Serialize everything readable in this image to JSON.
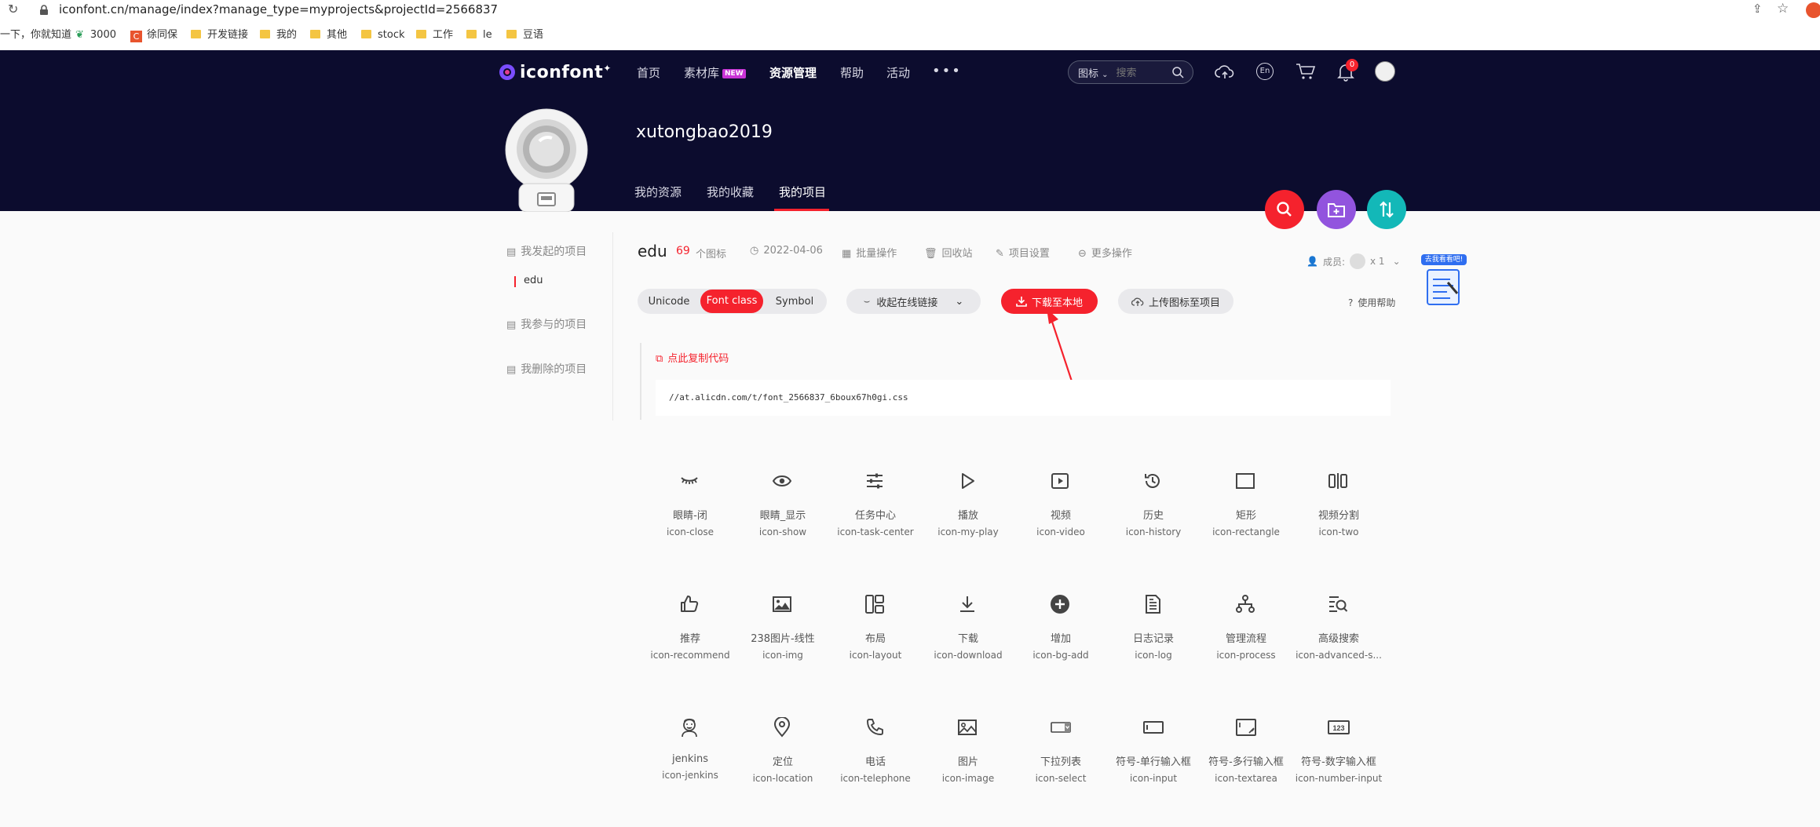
{
  "browser": {
    "url": "iconfont.cn/manage/index?manage_type=myprojects&projectId=2566837",
    "bookmarks": [
      "一下，你就知道",
      "3000",
      "徐同保",
      "开发链接",
      "我的",
      "其他",
      "stock",
      "工作",
      "le",
      "豆语"
    ]
  },
  "header": {
    "logo": "iconfont",
    "nav": [
      "首页",
      "素材库",
      "资源管理",
      "帮助",
      "活动"
    ],
    "nav_badge": "NEW",
    "search_scope": "图标",
    "search_placeholder": "搜索",
    "lang": "En",
    "notif_count": "0",
    "username": "xutongbao2019",
    "subnav": [
      "我的资源",
      "我的收藏",
      "我的项目"
    ]
  },
  "sidebar": {
    "initiated": "我发起的项目",
    "project": "edu",
    "joined": "我参与的项目",
    "deleted": "我删除的项目"
  },
  "project": {
    "name": "edu",
    "count": "69",
    "count_label": "个图标",
    "date": "2022-04-06",
    "actions": [
      "批量操作",
      "回收站",
      "项目设置",
      "更多操作"
    ],
    "members_label": "成员:",
    "members_count": "x 1",
    "tabs": [
      "Unicode",
      "Font class",
      "Symbol"
    ],
    "collapse": "收起在线链接",
    "download": "下载至本地",
    "upload": "上传图标至项目",
    "help": "使用帮助",
    "copy_code": "点此复制代码",
    "code_url": "//at.alicdn.com/t/font_2566837_6boux67h0gi.css",
    "promo": "去我看看吧!"
  },
  "icons": [
    {
      "cn": "眼睛-闭",
      "en": "icon-close",
      "glyph": "eye-closed"
    },
    {
      "cn": "眼睛_显示",
      "en": "icon-show",
      "glyph": "eye"
    },
    {
      "cn": "任务中心",
      "en": "icon-task-center",
      "glyph": "sliders"
    },
    {
      "cn": "播放",
      "en": "icon-my-play",
      "glyph": "play"
    },
    {
      "cn": "视频",
      "en": "icon-video",
      "glyph": "video"
    },
    {
      "cn": "历史",
      "en": "icon-history",
      "glyph": "history"
    },
    {
      "cn": "矩形",
      "en": "icon-rectangle",
      "glyph": "rectangle"
    },
    {
      "cn": "视频分割",
      "en": "icon-two",
      "glyph": "split"
    },
    {
      "cn": "推荐",
      "en": "icon-recommend",
      "glyph": "thumb"
    },
    {
      "cn": "238图片-线性",
      "en": "icon-img",
      "glyph": "picture"
    },
    {
      "cn": "布局",
      "en": "icon-layout",
      "glyph": "layout"
    },
    {
      "cn": "下载",
      "en": "icon-download",
      "glyph": "download"
    },
    {
      "cn": "增加",
      "en": "icon-bg-add",
      "glyph": "plus-circle"
    },
    {
      "cn": "日志记录",
      "en": "icon-log",
      "glyph": "log"
    },
    {
      "cn": "管理流程",
      "en": "icon-process",
      "glyph": "process"
    },
    {
      "cn": "高级搜索",
      "en": "icon-advanced-s...",
      "glyph": "adv-search"
    },
    {
      "cn": "jenkins",
      "en": "icon-jenkins",
      "glyph": "jenkins"
    },
    {
      "cn": "定位",
      "en": "icon-location",
      "glyph": "location"
    },
    {
      "cn": "电话",
      "en": "icon-telephone",
      "glyph": "phone"
    },
    {
      "cn": "图片",
      "en": "icon-image",
      "glyph": "image"
    },
    {
      "cn": "下拉列表",
      "en": "icon-select",
      "glyph": "select"
    },
    {
      "cn": "符号-单行输入框",
      "en": "icon-input",
      "glyph": "input"
    },
    {
      "cn": "符号-多行输入框",
      "en": "icon-textarea",
      "glyph": "textarea"
    },
    {
      "cn": "符号-数字输入框",
      "en": "icon-number-input",
      "glyph": "number"
    }
  ]
}
